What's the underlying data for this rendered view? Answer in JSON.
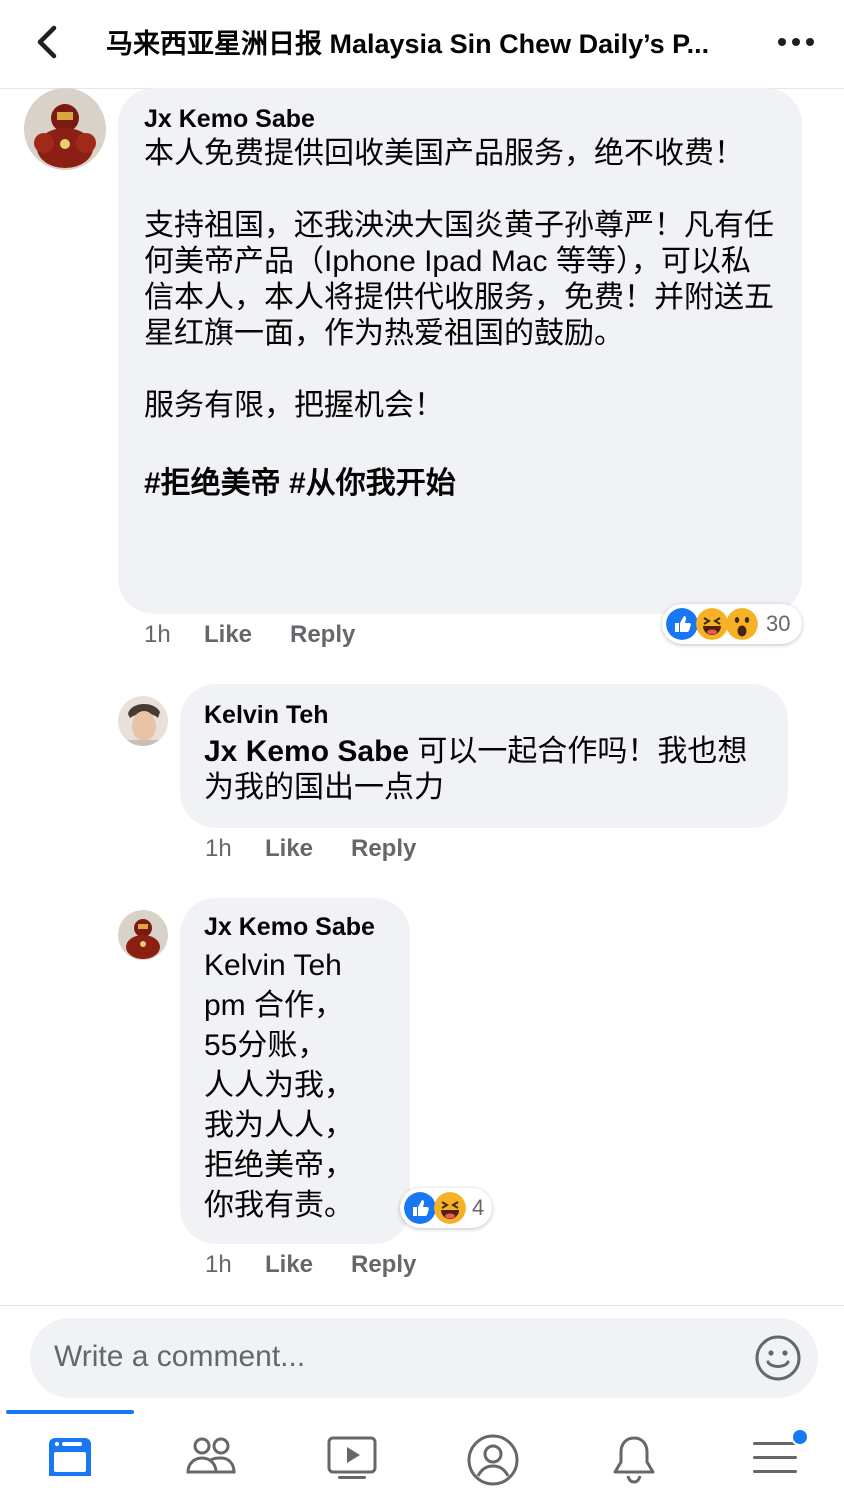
{
  "header": {
    "title": "马来西亚星洲日报 Malaysia Sin Chew Daily’s P..."
  },
  "comments": [
    {
      "author": "Jx Kemo Sabe",
      "paragraphs": [
        "本人免费提供回收美国产品服务，绝不收费！",
        "支持祖国，还我泱泱大国炎黄子孙尊严！凡有任何美帝产品（Iphone Ipad Mac 等等），可以私信本人，本人将提供代收服务，免费！并附送五星红旗一面，作为热爱祖国的鼓励。",
        "服务有限，把握机会！",
        "#拒绝美帝 #从你我开始"
      ],
      "time": "1h",
      "like_label": "Like",
      "reply_label": "Reply",
      "reaction_count": "30",
      "reactions": [
        "like-icon",
        "haha-icon",
        "wow-icon"
      ]
    },
    {
      "author": "Kelvin Teh",
      "mention": "Jx Kemo Sabe",
      "text": " 可以一起合作吗！我也想为我的国出一点力",
      "time": "1h",
      "like_label": "Like",
      "reply_label": "Reply"
    },
    {
      "author": "Jx Kemo Sabe",
      "mention": "Kelvin Teh",
      "lines": [
        "pm 合作，",
        "55分账，",
        "人人为我，",
        "我为人人，",
        "拒绝美帝，",
        "你我有责。"
      ],
      "time": "1h",
      "like_label": "Like",
      "reply_label": "Reply",
      "reaction_count": "4",
      "reactions": [
        "like-icon",
        "haha-icon"
      ]
    }
  ],
  "composer": {
    "placeholder": "Write a comment..."
  },
  "tabbar": {
    "items": [
      "news-feed-icon",
      "groups-icon",
      "watch-icon",
      "profile-icon",
      "notifications-icon",
      "menu-icon"
    ],
    "active": "news-feed-icon",
    "accent": "#1877f2"
  }
}
